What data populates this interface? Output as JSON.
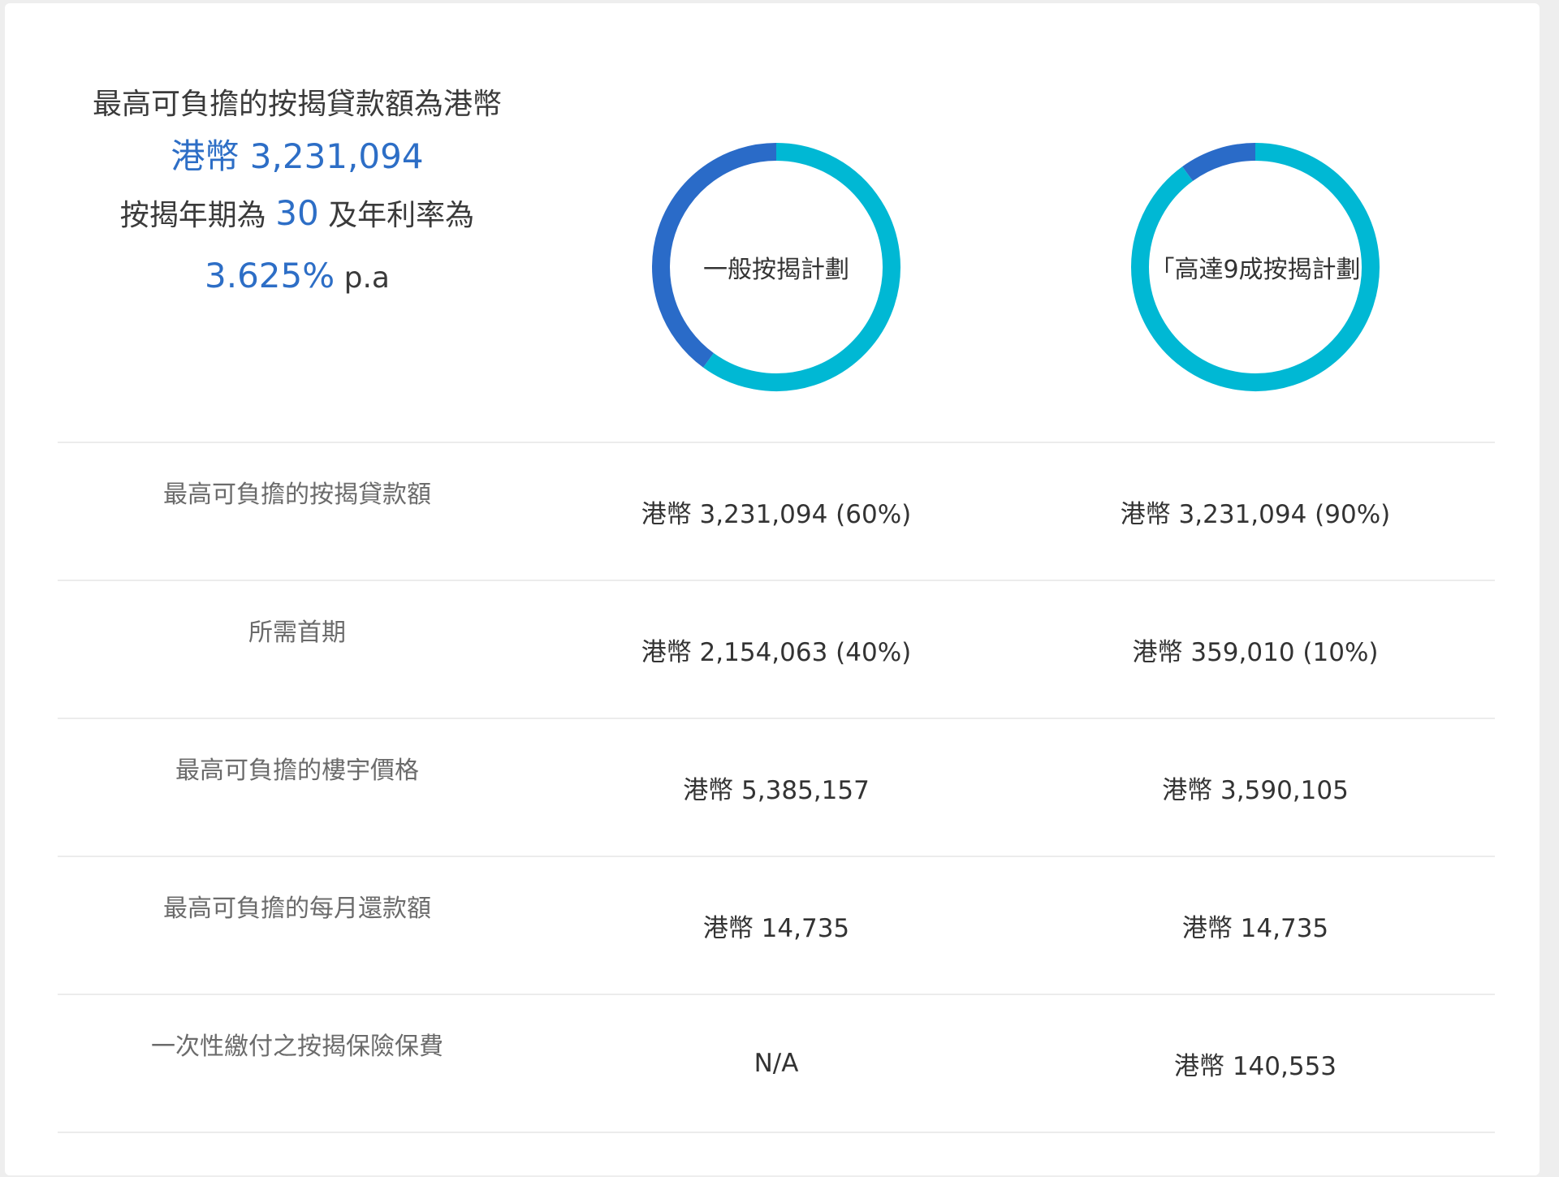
{
  "summary": {
    "line1": "最高可負擔的按揭貸款額為港幣",
    "amount": "港幣 3,231,094",
    "tenor_prefix": "按揭年期為",
    "tenor_value": "30",
    "tenor_suffix": "及年利率為",
    "rate_value": "3.625%",
    "rate_suffix": "p.a"
  },
  "charts": [
    {
      "label": "一般按揭計劃",
      "loan_fraction": 0.6,
      "colors": {
        "loan": "#00b8d4",
        "downpayment": "#2a6bc8"
      }
    },
    {
      "label": "「高達9成按揭計劃",
      "loan_fraction": 0.9,
      "colors": {
        "loan": "#00b8d4",
        "downpayment": "#2a6bc8"
      }
    }
  ],
  "rows": [
    {
      "label": "最高可負擔的按揭貸款額",
      "plan_a": "港幣 3,231,094 (60%)",
      "plan_b": "港幣 3,231,094 (90%)"
    },
    {
      "label": "所需首期",
      "plan_a": "港幣 2,154,063 (40%)",
      "plan_b": "港幣 359,010 (10%)"
    },
    {
      "label": "最高可負擔的樓宇價格",
      "plan_a": "港幣 5,385,157",
      "plan_b": "港幣 3,590,105"
    },
    {
      "label": "最高可負擔的每月還款額",
      "plan_a": "港幣 14,735",
      "plan_b": "港幣 14,735"
    },
    {
      "label": "一次性繳付之按揭保險保費",
      "plan_a": "N/A",
      "plan_b": "港幣 140,553"
    }
  ]
}
